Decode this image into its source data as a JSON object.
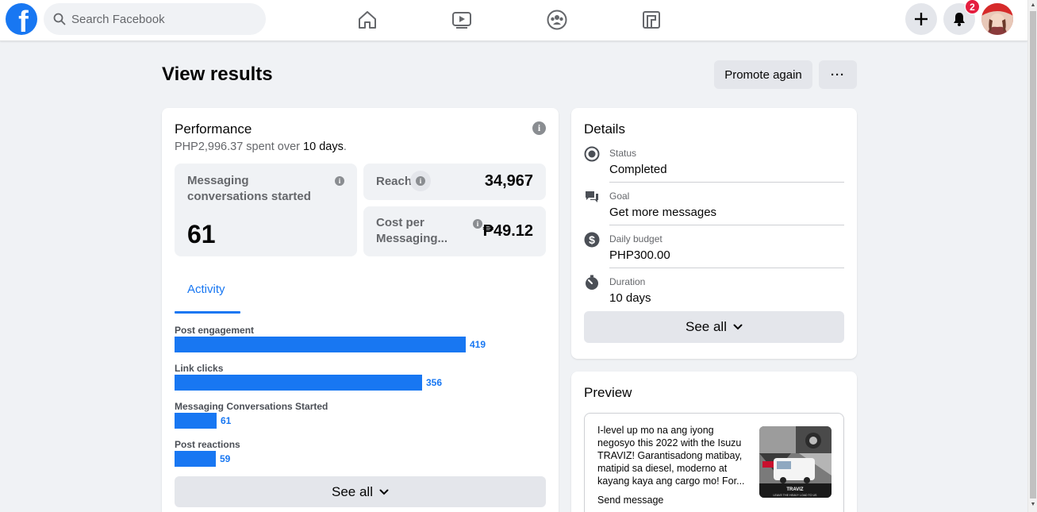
{
  "search": {
    "placeholder": "Search Facebook"
  },
  "notifications": {
    "count": "2"
  },
  "page": {
    "title": "View results",
    "promote_label": "Promote again",
    "more_label": "···"
  },
  "performance": {
    "title": "Performance",
    "spent_amount": "PHP2,996.37",
    "spent_mid": " spent over ",
    "spent_days": "10 days",
    "spent_end": ".",
    "messaging_label": "Messaging conversations started",
    "messaging_value": "61",
    "reach_label": "Reach",
    "reach_value": "34,967",
    "cost_label_1": "Cost per",
    "cost_label_2": "Messaging...",
    "cost_value": "₱49.12",
    "tab_activity": "Activity",
    "see_all": "See all"
  },
  "chart_data": {
    "type": "bar",
    "categories": [
      "Post engagement",
      "Link clicks",
      "Messaging Conversations Started",
      "Post reactions"
    ],
    "values": [
      419,
      356,
      61,
      59
    ]
  },
  "details": {
    "title": "Details",
    "items": [
      {
        "label": "Status",
        "value": "Completed",
        "icon": "status-radio-icon"
      },
      {
        "label": "Goal",
        "value": "Get more messages",
        "icon": "chat-bubbles-icon"
      },
      {
        "label": "Daily budget",
        "value": "PHP300.00",
        "icon": "dollar-icon"
      },
      {
        "label": "Duration",
        "value": "10 days",
        "icon": "stopwatch-icon"
      }
    ],
    "see_all": "See all"
  },
  "preview": {
    "title": "Preview",
    "post_text": "I-level up mo na ang iyong negosyo this 2022 with the Isuzu TRAVIZ! Garantisadong matibay, matipid sa diesel, moderno at kayang kaya ang cargo mo! For...",
    "cta": "Send message",
    "image_brand": "TRAVIZ",
    "image_tagline": "LEAVE THE HEAVY LOAD TO US"
  },
  "colors": {
    "accent": "#1877f2",
    "badge": "#e41e3f",
    "surface": "#f0f2f5"
  }
}
